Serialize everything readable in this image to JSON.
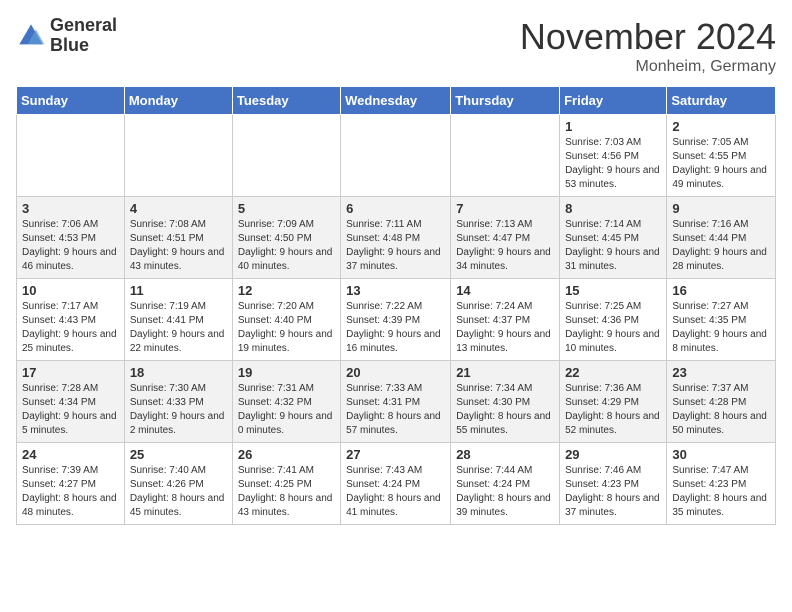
{
  "logo": {
    "line1": "General",
    "line2": "Blue"
  },
  "title": "November 2024",
  "location": "Monheim, Germany",
  "days_of_week": [
    "Sunday",
    "Monday",
    "Tuesday",
    "Wednesday",
    "Thursday",
    "Friday",
    "Saturday"
  ],
  "weeks": [
    [
      {
        "day": "",
        "info": ""
      },
      {
        "day": "",
        "info": ""
      },
      {
        "day": "",
        "info": ""
      },
      {
        "day": "",
        "info": ""
      },
      {
        "day": "",
        "info": ""
      },
      {
        "day": "1",
        "info": "Sunrise: 7:03 AM\nSunset: 4:56 PM\nDaylight: 9 hours and 53 minutes."
      },
      {
        "day": "2",
        "info": "Sunrise: 7:05 AM\nSunset: 4:55 PM\nDaylight: 9 hours and 49 minutes."
      }
    ],
    [
      {
        "day": "3",
        "info": "Sunrise: 7:06 AM\nSunset: 4:53 PM\nDaylight: 9 hours and 46 minutes."
      },
      {
        "day": "4",
        "info": "Sunrise: 7:08 AM\nSunset: 4:51 PM\nDaylight: 9 hours and 43 minutes."
      },
      {
        "day": "5",
        "info": "Sunrise: 7:09 AM\nSunset: 4:50 PM\nDaylight: 9 hours and 40 minutes."
      },
      {
        "day": "6",
        "info": "Sunrise: 7:11 AM\nSunset: 4:48 PM\nDaylight: 9 hours and 37 minutes."
      },
      {
        "day": "7",
        "info": "Sunrise: 7:13 AM\nSunset: 4:47 PM\nDaylight: 9 hours and 34 minutes."
      },
      {
        "day": "8",
        "info": "Sunrise: 7:14 AM\nSunset: 4:45 PM\nDaylight: 9 hours and 31 minutes."
      },
      {
        "day": "9",
        "info": "Sunrise: 7:16 AM\nSunset: 4:44 PM\nDaylight: 9 hours and 28 minutes."
      }
    ],
    [
      {
        "day": "10",
        "info": "Sunrise: 7:17 AM\nSunset: 4:43 PM\nDaylight: 9 hours and 25 minutes."
      },
      {
        "day": "11",
        "info": "Sunrise: 7:19 AM\nSunset: 4:41 PM\nDaylight: 9 hours and 22 minutes."
      },
      {
        "day": "12",
        "info": "Sunrise: 7:20 AM\nSunset: 4:40 PM\nDaylight: 9 hours and 19 minutes."
      },
      {
        "day": "13",
        "info": "Sunrise: 7:22 AM\nSunset: 4:39 PM\nDaylight: 9 hours and 16 minutes."
      },
      {
        "day": "14",
        "info": "Sunrise: 7:24 AM\nSunset: 4:37 PM\nDaylight: 9 hours and 13 minutes."
      },
      {
        "day": "15",
        "info": "Sunrise: 7:25 AM\nSunset: 4:36 PM\nDaylight: 9 hours and 10 minutes."
      },
      {
        "day": "16",
        "info": "Sunrise: 7:27 AM\nSunset: 4:35 PM\nDaylight: 9 hours and 8 minutes."
      }
    ],
    [
      {
        "day": "17",
        "info": "Sunrise: 7:28 AM\nSunset: 4:34 PM\nDaylight: 9 hours and 5 minutes."
      },
      {
        "day": "18",
        "info": "Sunrise: 7:30 AM\nSunset: 4:33 PM\nDaylight: 9 hours and 2 minutes."
      },
      {
        "day": "19",
        "info": "Sunrise: 7:31 AM\nSunset: 4:32 PM\nDaylight: 9 hours and 0 minutes."
      },
      {
        "day": "20",
        "info": "Sunrise: 7:33 AM\nSunset: 4:31 PM\nDaylight: 8 hours and 57 minutes."
      },
      {
        "day": "21",
        "info": "Sunrise: 7:34 AM\nSunset: 4:30 PM\nDaylight: 8 hours and 55 minutes."
      },
      {
        "day": "22",
        "info": "Sunrise: 7:36 AM\nSunset: 4:29 PM\nDaylight: 8 hours and 52 minutes."
      },
      {
        "day": "23",
        "info": "Sunrise: 7:37 AM\nSunset: 4:28 PM\nDaylight: 8 hours and 50 minutes."
      }
    ],
    [
      {
        "day": "24",
        "info": "Sunrise: 7:39 AM\nSunset: 4:27 PM\nDaylight: 8 hours and 48 minutes."
      },
      {
        "day": "25",
        "info": "Sunrise: 7:40 AM\nSunset: 4:26 PM\nDaylight: 8 hours and 45 minutes."
      },
      {
        "day": "26",
        "info": "Sunrise: 7:41 AM\nSunset: 4:25 PM\nDaylight: 8 hours and 43 minutes."
      },
      {
        "day": "27",
        "info": "Sunrise: 7:43 AM\nSunset: 4:24 PM\nDaylight: 8 hours and 41 minutes."
      },
      {
        "day": "28",
        "info": "Sunrise: 7:44 AM\nSunset: 4:24 PM\nDaylight: 8 hours and 39 minutes."
      },
      {
        "day": "29",
        "info": "Sunrise: 7:46 AM\nSunset: 4:23 PM\nDaylight: 8 hours and 37 minutes."
      },
      {
        "day": "30",
        "info": "Sunrise: 7:47 AM\nSunset: 4:23 PM\nDaylight: 8 hours and 35 minutes."
      }
    ]
  ]
}
